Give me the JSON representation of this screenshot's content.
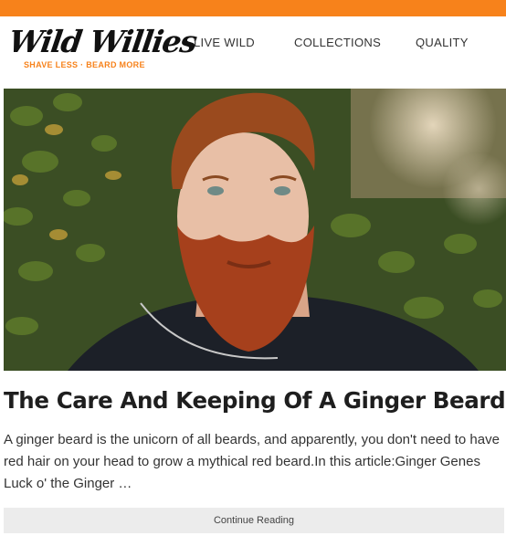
{
  "colors": {
    "accent": "#f7821b",
    "beard": "#a6401c",
    "text": "#222222",
    "button_bg": "#ececec"
  },
  "brand": {
    "name": "Wild Willies",
    "tagline": "SHAVE LESS · BEARD MORE"
  },
  "nav": {
    "items": [
      "LIVE WILD",
      "COLLECTIONS",
      "QUALITY"
    ]
  },
  "article": {
    "title": "The Care And Keeping Of A Ginger Beard",
    "excerpt": "A ginger beard is the unicorn of all beards, and apparently, you don't need to have red hair on your head to grow a mythical red beard.In this article:Ginger Genes Luck o' the Ginger …",
    "button_label": "Continue Reading"
  }
}
